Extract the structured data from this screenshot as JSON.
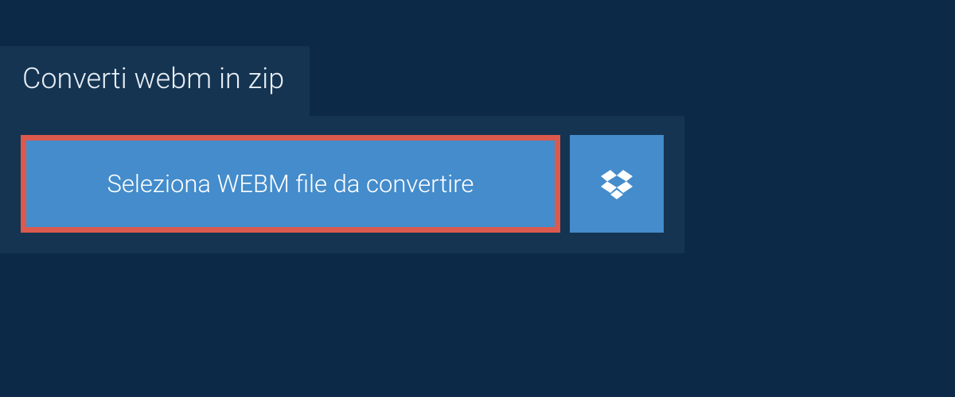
{
  "tab": {
    "title": "Converti webm in zip"
  },
  "actions": {
    "select_file_label": "Seleziona WEBM file da convertire"
  },
  "colors": {
    "background": "#0c2a47",
    "panel": "#143452",
    "button": "#448ccb",
    "highlight_border": "#db5a4d",
    "text": "#ffffff"
  }
}
